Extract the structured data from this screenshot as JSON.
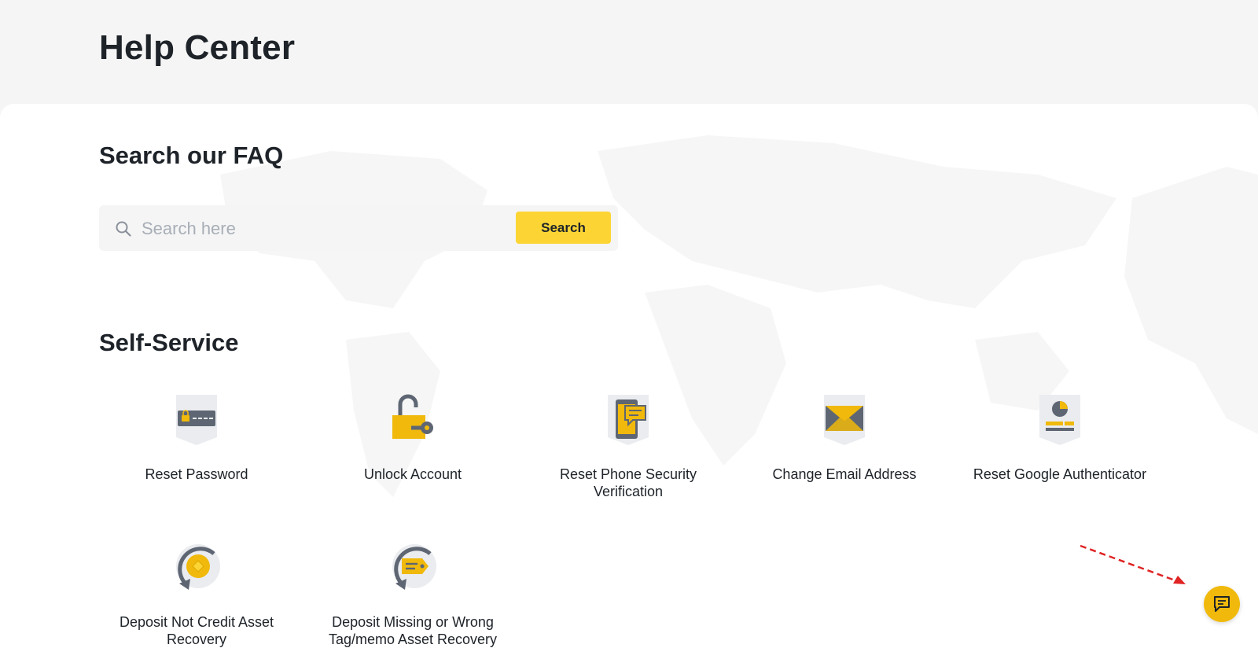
{
  "header": {
    "title": "Help Center"
  },
  "faq": {
    "title": "Search our FAQ",
    "search_placeholder": "Search here",
    "search_button": "Search"
  },
  "self_service": {
    "title": "Self-Service",
    "items": [
      {
        "label": "Reset Password",
        "icon": "reset-password-icon"
      },
      {
        "label": "Unlock Account",
        "icon": "unlock-account-icon"
      },
      {
        "label": "Reset Phone Security Verification",
        "icon": "phone-verification-icon"
      },
      {
        "label": "Change Email Address",
        "icon": "email-icon"
      },
      {
        "label": "Reset Google Authenticator",
        "icon": "google-authenticator-icon"
      },
      {
        "label": "Deposit Not Credit Asset Recovery",
        "icon": "deposit-recovery-icon"
      },
      {
        "label": "Deposit Missing or Wrong Tag/memo Asset Recovery",
        "icon": "deposit-tag-memo-icon"
      }
    ]
  },
  "chat": {
    "icon": "chat-icon"
  },
  "colors": {
    "accent": "#fcd535",
    "chat_button": "#f0b90b",
    "annotation_arrow": "#e02424",
    "icon_gray": "#8a909b"
  }
}
